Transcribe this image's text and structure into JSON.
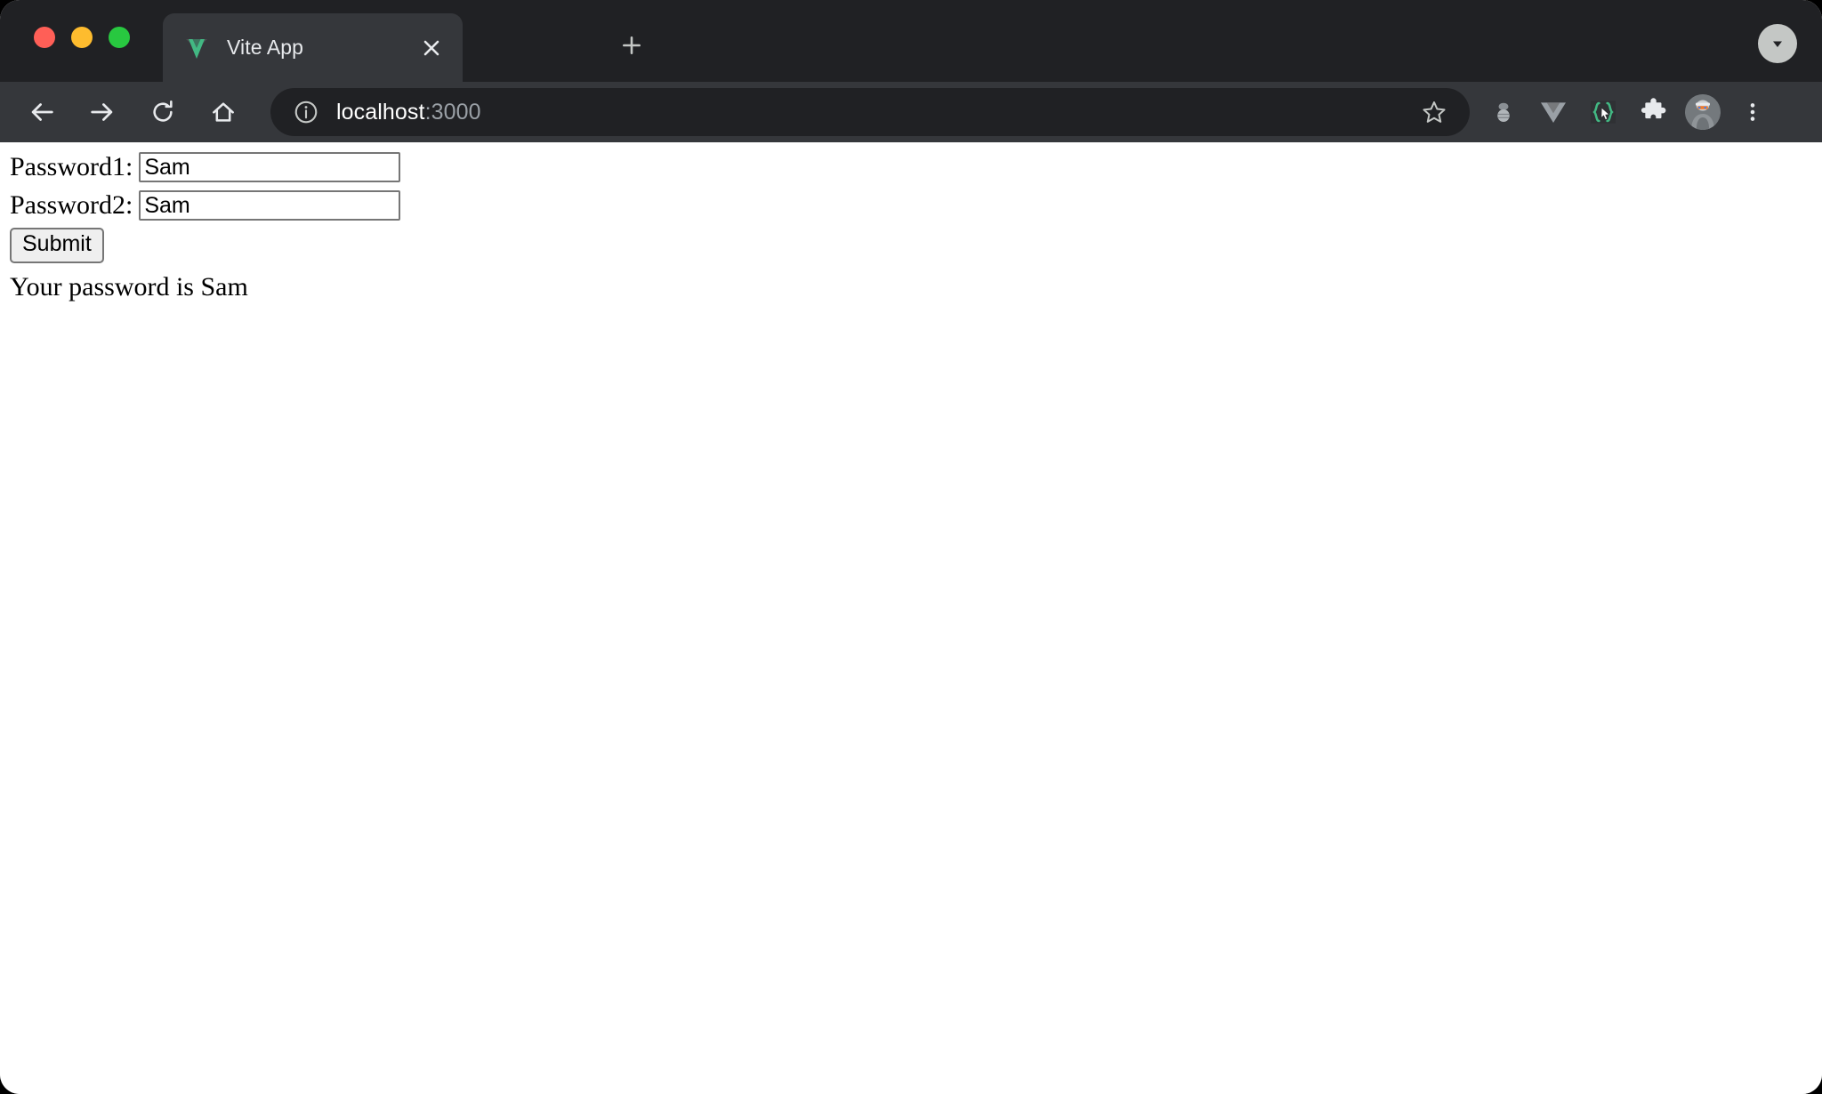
{
  "browser": {
    "window_controls": [
      {
        "name": "close",
        "color": "#ff5f57"
      },
      {
        "name": "minimize",
        "color": "#febc2e"
      },
      {
        "name": "maximize",
        "color": "#28c840"
      }
    ],
    "tab": {
      "title": "Vite App",
      "favicon": "vite-vue-logo-icon",
      "close_label": "×"
    },
    "new_tab_label": "+",
    "tab_search": "chevron-down-icon",
    "nav": {
      "back": "back-arrow-icon",
      "forward": "forward-arrow-icon",
      "reload": "reload-icon",
      "home": "home-icon"
    },
    "omnibox": {
      "site_info": "info-circle-icon",
      "url_host": "localhost",
      "url_port": ":3000",
      "bookmark": "star-icon"
    },
    "toolbar_icons": [
      "extension-gray-icon",
      "vue-devtools-icon",
      "code-cursor-extension-icon",
      "puzzle-extensions-icon",
      "profile-avatar",
      "three-dot-menu-icon"
    ],
    "accent_colors": {
      "tabstrip_bg": "#202124",
      "toolbar_bg": "#35373b",
      "omnibox_bg": "#202124",
      "tab_active_bg": "#35373b",
      "text": "#e8eaed",
      "muted_text": "#9aa0a6",
      "vue_green": "#42b883"
    }
  },
  "page": {
    "fields": [
      {
        "label": "Password1:",
        "value": "Sam",
        "placeholder": ""
      },
      {
        "label": "Password2:",
        "value": "Sam",
        "placeholder": ""
      }
    ],
    "submit_label": "Submit",
    "result_text": "Your password is Sam"
  }
}
